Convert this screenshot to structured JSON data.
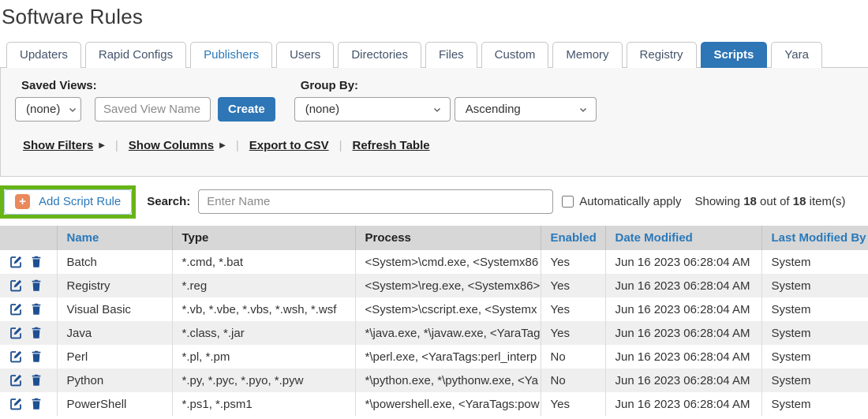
{
  "page": {
    "title": "Software Rules"
  },
  "colors": {
    "accent_blue": "#2e76b6",
    "link_blue": "#2a79ba",
    "icon_navy": "#1d4f91",
    "plus_orange": "#e9895c",
    "highlight_green": "#67b417",
    "header_dark": "#222222"
  },
  "tabs": [
    {
      "label": "Updaters",
      "active": false,
      "highlight": false
    },
    {
      "label": "Rapid Configs",
      "active": false,
      "highlight": false
    },
    {
      "label": "Publishers",
      "active": false,
      "highlight": true
    },
    {
      "label": "Users",
      "active": false,
      "highlight": false
    },
    {
      "label": "Directories",
      "active": false,
      "highlight": false
    },
    {
      "label": "Files",
      "active": false,
      "highlight": false
    },
    {
      "label": "Custom",
      "active": false,
      "highlight": false
    },
    {
      "label": "Memory",
      "active": false,
      "highlight": false
    },
    {
      "label": "Registry",
      "active": false,
      "highlight": false
    },
    {
      "label": "Scripts",
      "active": true,
      "highlight": false
    },
    {
      "label": "Yara",
      "active": false,
      "highlight": false
    }
  ],
  "filter_panel": {
    "saved_views_label": "Saved Views:",
    "saved_views_value": "(none)",
    "saved_view_name_placeholder": "Saved View Name",
    "create_label": "Create",
    "group_by_label": "Group By:",
    "group_by_value": "(none)",
    "sort_order_value": "Ascending",
    "links": [
      {
        "label": "Show Filters",
        "arrow": true
      },
      {
        "label": "Show Columns",
        "arrow": true
      },
      {
        "label": "Export to CSV",
        "arrow": false
      },
      {
        "label": "Refresh Table",
        "arrow": false
      }
    ]
  },
  "toolbar": {
    "add_rule_label": "Add Script Rule",
    "search_label": "Search:",
    "search_placeholder": "Enter Name",
    "auto_apply_label": "Automatically apply",
    "showing": {
      "prefix": "Showing ",
      "count": "18",
      "middle": " out of ",
      "total": "18",
      "suffix": " item(s)"
    }
  },
  "icons": {
    "add": "plus-icon",
    "edit": "pencil-square-icon",
    "delete": "trash-icon",
    "select": "chevron-down-icon",
    "link_arrow": "triangle-right-icon"
  },
  "table": {
    "headers": [
      {
        "label": "Name",
        "sortable": true
      },
      {
        "label": "Type",
        "sortable": false
      },
      {
        "label": "Process",
        "sortable": false
      },
      {
        "label": "Enabled",
        "sortable": true
      },
      {
        "label": "Date Modified",
        "sortable": true
      },
      {
        "label": "Last Modified By",
        "sortable": true
      }
    ],
    "rows": [
      {
        "name": "Batch",
        "type": "*.cmd, *.bat",
        "process": "<System>\\cmd.exe, <Systemx86",
        "enabled": "Yes",
        "date_modified": "Jun 16 2023 06:28:04 AM",
        "last_modified_by": "System"
      },
      {
        "name": "Registry",
        "type": "*.reg",
        "process": "<System>\\reg.exe, <Systemx86>",
        "enabled": "Yes",
        "date_modified": "Jun 16 2023 06:28:04 AM",
        "last_modified_by": "System"
      },
      {
        "name": "Visual Basic",
        "type": "*.vb, *.vbe, *.vbs, *.wsh, *.wsf",
        "process": "<System>\\cscript.exe, <Systemx",
        "enabled": "Yes",
        "date_modified": "Jun 16 2023 06:28:04 AM",
        "last_modified_by": "System"
      },
      {
        "name": "Java",
        "type": "*.class, *.jar",
        "process": "*\\java.exe, *\\javaw.exe, <YaraTag",
        "enabled": "Yes",
        "date_modified": "Jun 16 2023 06:28:04 AM",
        "last_modified_by": "System"
      },
      {
        "name": "Perl",
        "type": "*.pl, *.pm",
        "process": "*\\perl.exe, <YaraTags:perl_interp",
        "enabled": "No",
        "date_modified": "Jun 16 2023 06:28:04 AM",
        "last_modified_by": "System"
      },
      {
        "name": "Python",
        "type": "*.py, *.pyc, *.pyo, *.pyw",
        "process": "*\\python.exe, *\\pythonw.exe, <Ya",
        "enabled": "No",
        "date_modified": "Jun 16 2023 06:28:04 AM",
        "last_modified_by": "System"
      },
      {
        "name": "PowerShell",
        "type": "*.ps1, *.psm1",
        "process": "*\\powershell.exe, <YaraTags:pow",
        "enabled": "Yes",
        "date_modified": "Jun 16 2023 06:28:04 AM",
        "last_modified_by": "System"
      }
    ]
  }
}
